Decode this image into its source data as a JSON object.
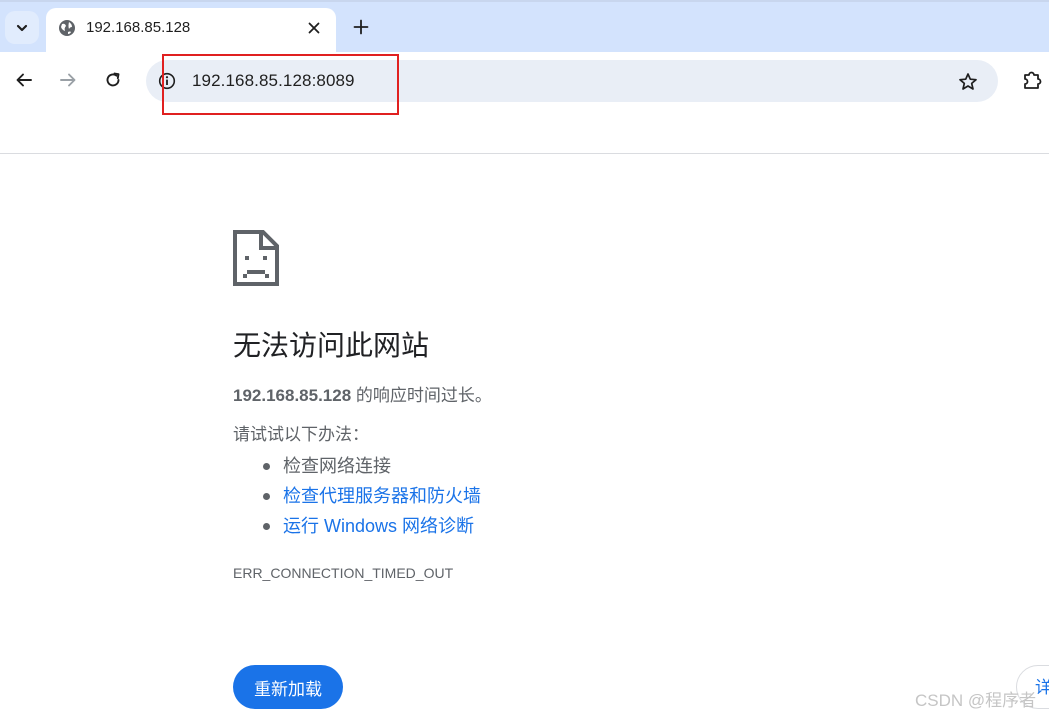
{
  "browser": {
    "tab": {
      "title": "192.168.85.128",
      "favicon": "globe-icon"
    },
    "tab_search_icon": "chevron-down-icon",
    "new_tab_icon": "plus-icon",
    "toolbar": {
      "back_icon": "arrow-left-icon",
      "forward_icon": "arrow-right-icon",
      "reload_icon": "reload-icon",
      "site_info_icon": "info-icon",
      "url": "192.168.85.128:8089",
      "bookmark_icon": "star-icon",
      "extensions_icon": "puzzle-icon"
    },
    "highlight_color": "#e02020"
  },
  "error_page": {
    "title": "无法访问此网站",
    "host": "192.168.85.128",
    "message_suffix": " 的响应时间过长。",
    "suggest_heading": "请试试以下办法：",
    "suggestions": [
      {
        "text": "检查网络连接",
        "is_link": false
      },
      {
        "text": "检查代理服务器和防火墙",
        "is_link": true
      },
      {
        "text": "运行 Windows 网络诊断",
        "is_link": true
      }
    ],
    "error_code": "ERR_CONNECTION_TIMED_OUT",
    "reload_label": "重新加载",
    "details_label": "详",
    "accent_color": "#1a73e8"
  },
  "watermark": "CSDN @程序者"
}
